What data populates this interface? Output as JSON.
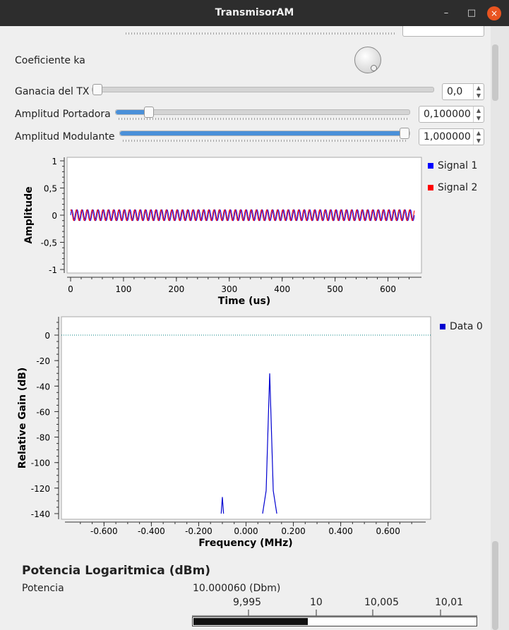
{
  "window": {
    "title": "TransmisorAM",
    "minimize": "–",
    "maximize": "□",
    "close": "×"
  },
  "controls": {
    "ka_label": "Coeficiente ka",
    "gain": {
      "label": "Ganacia del TX",
      "value": "0,0",
      "fraction": 0.0
    },
    "carrier": {
      "label": "Amplitud Portadora",
      "value": "0,100000",
      "fraction": 0.1
    },
    "modulating": {
      "label": "Amplitud Modulante",
      "value": "1,000000",
      "fraction": 1.0
    }
  },
  "colors": {
    "signal1": "#0000ff",
    "signal2": "#ff0000",
    "data0": "#0000d0",
    "slider": "#4a90d9",
    "close": "#e95420"
  },
  "chart_data": [
    {
      "type": "line",
      "title": "",
      "xlabel": "Time (us)",
      "ylabel": "Amplitude",
      "xlim": [
        0,
        650
      ],
      "ylim": [
        -1,
        1
      ],
      "xticks": [
        "0",
        "100",
        "200",
        "300",
        "400",
        "500",
        "600"
      ],
      "yticks": [
        "1",
        "0,5",
        "0",
        "-0,5",
        "-1"
      ],
      "legend": "right",
      "series": [
        {
          "name": "Signal 1",
          "amplitude": 0.1,
          "cycles": 65,
          "phase": 0
        },
        {
          "name": "Signal 2",
          "amplitude": 0.1,
          "cycles": 65,
          "phase": 1.0
        }
      ]
    },
    {
      "type": "line",
      "title": "",
      "xlabel": "Frequency (MHz)",
      "ylabel": "Relative Gain (dB)",
      "xlim": [
        -0.78,
        0.78
      ],
      "ylim": [
        -140,
        10
      ],
      "xticks": [
        "-0.600",
        "-0.400",
        "-0.200",
        "0.000",
        "0.200",
        "0.400",
        "0.600"
      ],
      "yticks": [
        "0",
        "-20",
        "-40",
        "-60",
        "-80",
        "-100",
        "-120",
        "-140"
      ],
      "legend": "right",
      "reference_level": 0,
      "series": [
        {
          "name": "Data 0",
          "x": [
            -0.105,
            -0.1,
            -0.095,
            0.07,
            0.085,
            0.095,
            0.1,
            0.105,
            0.115,
            0.13
          ],
          "y": [
            -140,
            -127,
            -140,
            -140,
            -122,
            -60,
            -30,
            -60,
            -122,
            -140
          ]
        }
      ]
    }
  ],
  "power": {
    "title": "Potencia Logaritmica (dBm)",
    "label": "Potencia",
    "value": "10.000060 (Dbm)",
    "scale": [
      "9,995",
      "10",
      "10,005",
      "10,01"
    ],
    "range": [
      9.99,
      10.015
    ],
    "level": 10.00006
  }
}
